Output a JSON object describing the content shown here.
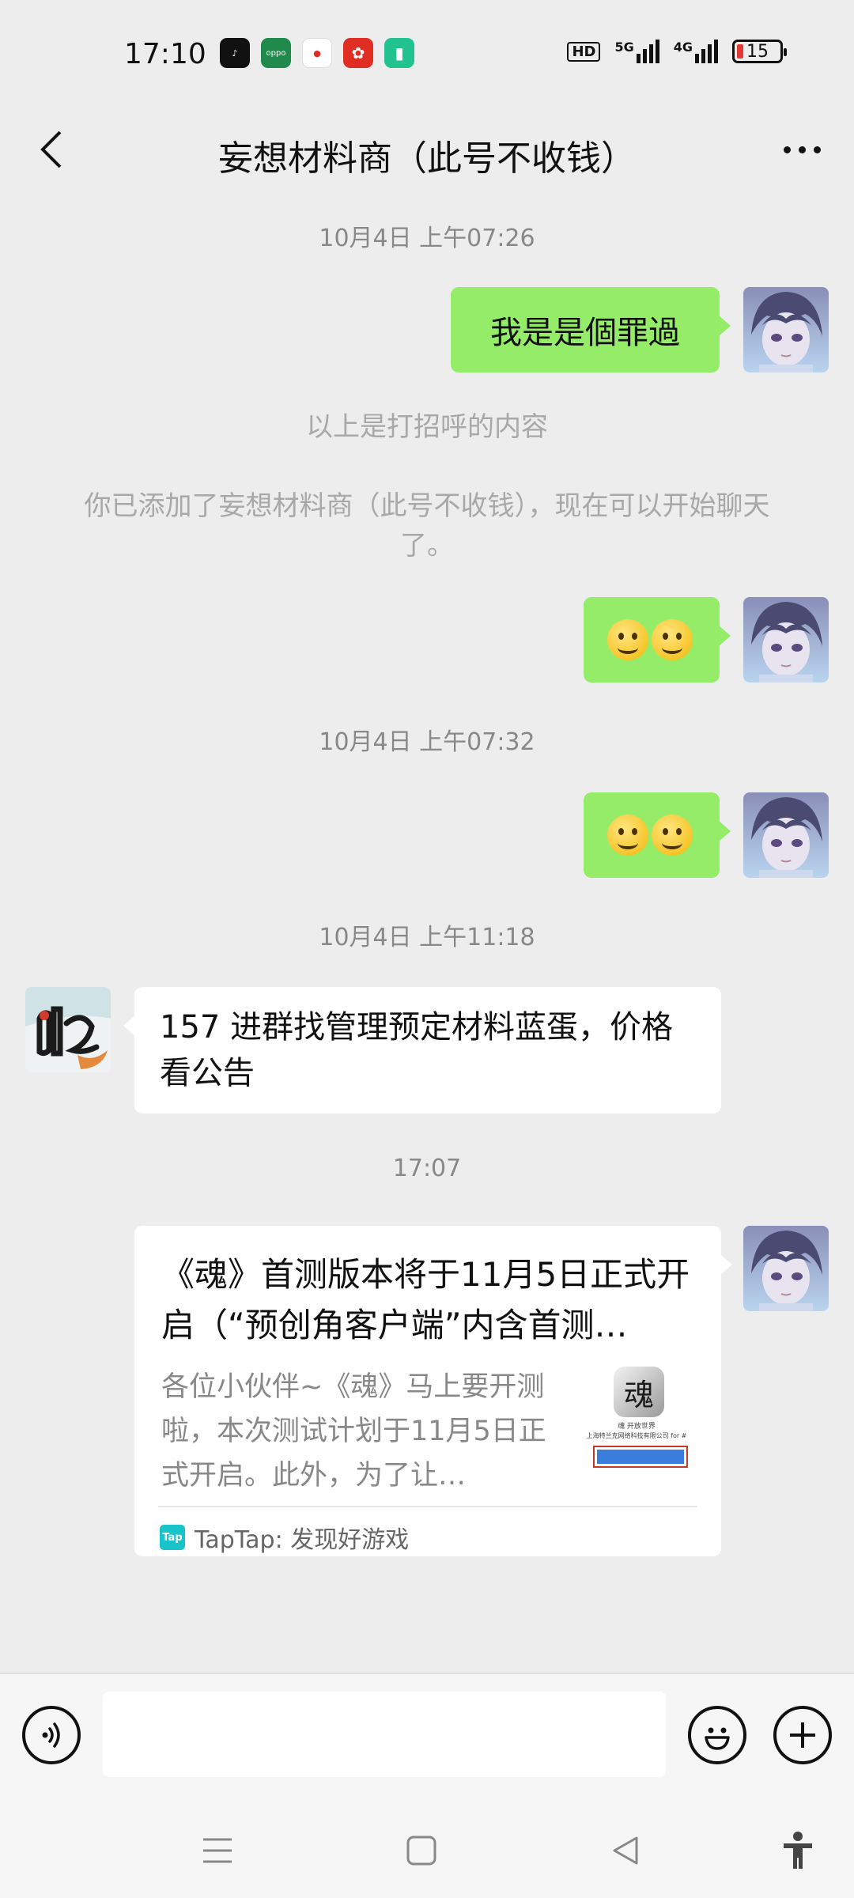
{
  "status_bar": {
    "time": "17:10",
    "app_icons": [
      {
        "name": "douyin-icon",
        "color": "#111111",
        "glyph": "♪"
      },
      {
        "name": "oppo-icon",
        "color": "#1f8a4c",
        "glyph": "oppo"
      },
      {
        "name": "map-pin-icon",
        "color": "#ffffff",
        "glyph": "du"
      },
      {
        "name": "pinduoduo-icon",
        "color": "#e02e24",
        "glyph": "✿"
      },
      {
        "name": "battery-saver-icon",
        "color": "#22c38e",
        "glyph": "▯"
      }
    ],
    "hd_label": "HD",
    "net1_label": "5G",
    "net2_label": "4G",
    "battery_level": "15"
  },
  "header": {
    "title": "妄想材料商（此号不收钱）"
  },
  "chat": {
    "ts1": "10月4日 上午07:26",
    "msg1": "我是是個罪過",
    "sys1": "以上是打招呼的内容",
    "sys2": "你已添加了妄想材料商（此号不收钱），现在可以开始聊天了。",
    "ts2": "10月4日 上午07:32",
    "ts3": "10月4日 上午11:18",
    "msg4": "157 进群找管理预定材料蓝蛋，价格看公告",
    "ts4": "17:07",
    "card": {
      "title": "《魂》首测版本将于11月5日正式开启（“预创角客户端”内含首测…",
      "desc": "各位小伙伴~《魂》马上要开测啦，本次测试计划于11月5日正式开启。此外，为了让…",
      "thumb_name": "魂 开放世界",
      "thumb_company": "上海特兰克网络科技有限公司 for #",
      "source": "TapTap: 发现好游戏",
      "source_logo": "Tap"
    }
  },
  "input_bar": {
    "placeholder": ""
  },
  "colors": {
    "my_bubble": "#95ec69",
    "other_bubble": "#ffffff",
    "background": "#ededed"
  }
}
